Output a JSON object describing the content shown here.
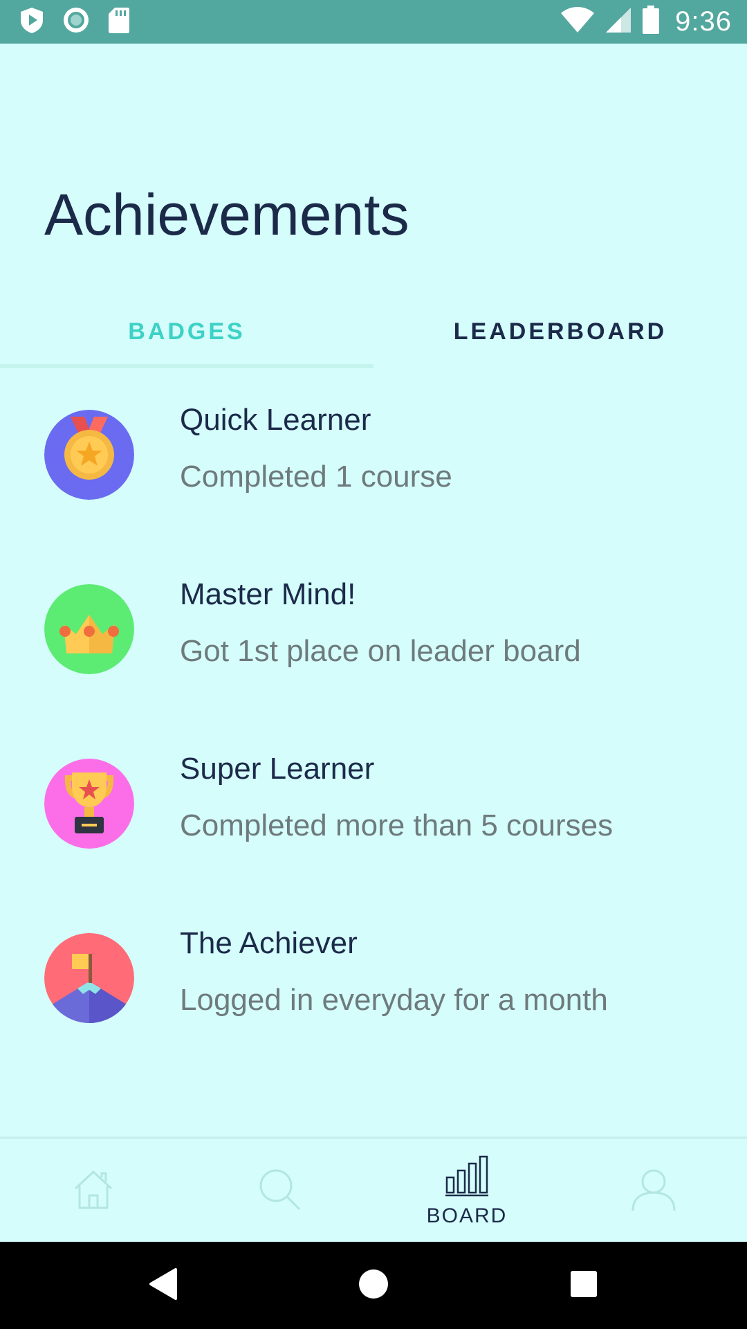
{
  "status_bar": {
    "time": "9:36",
    "icons": [
      "shield-play-icon",
      "record-icon",
      "sd-card-icon",
      "wifi-icon",
      "cell-signal-icon",
      "battery-icon"
    ]
  },
  "header": {
    "title": "Achievements"
  },
  "tabs": [
    {
      "label": "BADGES",
      "selected": true
    },
    {
      "label": "LEADERBOARD",
      "selected": false
    }
  ],
  "badges": [
    {
      "title": "Quick Learner",
      "description": "Completed 1 course",
      "icon": "medal-icon",
      "color": "#6a6bf0"
    },
    {
      "title": "Master Mind!",
      "description": "Got 1st place on leader board",
      "icon": "crown-icon",
      "color": "#5ceb73"
    },
    {
      "title": "Super Learner",
      "description": "Completed more than 5 courses",
      "icon": "trophy-icon",
      "color": "#fc6ee8"
    },
    {
      "title": "The Achiever",
      "description": "Logged in everyday for a month",
      "icon": "flag-mountain-icon",
      "color": "#ff6b77"
    }
  ],
  "bottom_nav": {
    "items": [
      {
        "icon": "home-icon",
        "label": "",
        "active": false
      },
      {
        "icon": "search-icon",
        "label": "",
        "active": false
      },
      {
        "icon": "bar-chart-icon",
        "label": "BOARD",
        "active": true
      },
      {
        "icon": "user-icon",
        "label": "",
        "active": false
      }
    ]
  },
  "colors": {
    "background": "#d4fdfb",
    "status_bar": "#52a79e",
    "accent": "#3ed1c6",
    "text_primary": "#1c2a4a",
    "text_secondary": "#6e7a7c"
  }
}
